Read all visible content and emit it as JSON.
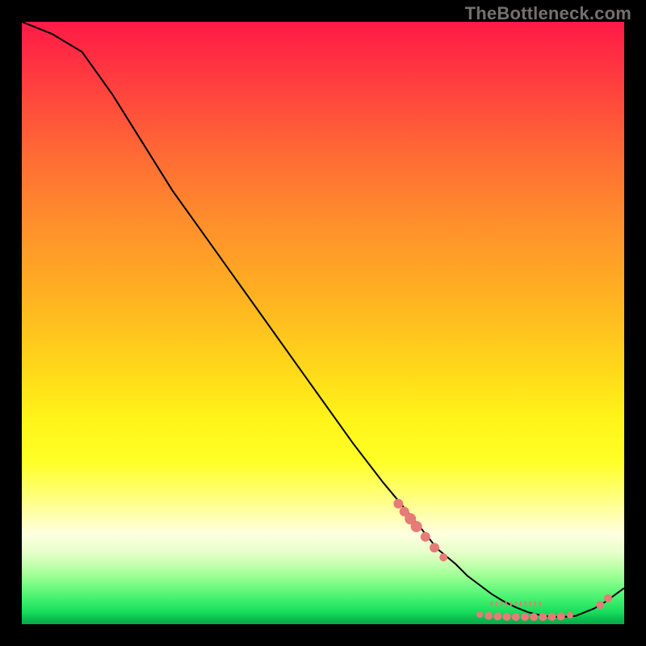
{
  "watermark": "TheBottleneck.com",
  "chart_data": {
    "type": "line",
    "title": "",
    "xlabel": "",
    "ylabel": "",
    "xlim": [
      0,
      100
    ],
    "ylim": [
      0,
      100
    ],
    "series": [
      {
        "name": "curve",
        "x": [
          0,
          5,
          10,
          15,
          20,
          25,
          30,
          35,
          40,
          45,
          50,
          55,
          60,
          65,
          67,
          69,
          72,
          74,
          76,
          78,
          80,
          82,
          84,
          86,
          88,
          90,
          92,
          95,
          97,
          100
        ],
        "y": [
          100,
          98,
          95,
          88,
          80,
          72,
          65,
          58,
          51,
          44,
          37,
          30,
          23.5,
          17.5,
          15,
          12.5,
          10,
          8,
          6.5,
          5,
          3.8,
          2.8,
          2,
          1.5,
          1.2,
          1.2,
          1.4,
          2.6,
          3.8,
          6
        ]
      }
    ],
    "markers": [
      {
        "x": 62.5,
        "y": 20,
        "r": 6
      },
      {
        "x": 63.5,
        "y": 18.7,
        "r": 6
      },
      {
        "x": 64.5,
        "y": 17.5,
        "r": 7
      },
      {
        "x": 65.5,
        "y": 16.2,
        "r": 7
      },
      {
        "x": 67,
        "y": 14.5,
        "r": 6
      },
      {
        "x": 68.5,
        "y": 12.7,
        "r": 6
      },
      {
        "x": 70,
        "y": 11.1,
        "r": 5
      },
      {
        "x": 76,
        "y": 1.6,
        "r": 4
      },
      {
        "x": 77.5,
        "y": 1.4,
        "r": 5
      },
      {
        "x": 79,
        "y": 1.3,
        "r": 5
      },
      {
        "x": 80.5,
        "y": 1.25,
        "r": 5
      },
      {
        "x": 82,
        "y": 1.2,
        "r": 5
      },
      {
        "x": 83.5,
        "y": 1.2,
        "r": 5
      },
      {
        "x": 85,
        "y": 1.2,
        "r": 5
      },
      {
        "x": 86.5,
        "y": 1.2,
        "r": 5
      },
      {
        "x": 88,
        "y": 1.25,
        "r": 5
      },
      {
        "x": 89.5,
        "y": 1.3,
        "r": 5
      },
      {
        "x": 91,
        "y": 1.5,
        "r": 4
      },
      {
        "x": 96,
        "y": 3.2,
        "r": 5
      },
      {
        "x": 97.3,
        "y": 4.3,
        "r": 5
      }
    ],
    "annotation": {
      "x": 82,
      "y": 3.4,
      "text": "",
      "color": "#f07878"
    },
    "colors": {
      "curve": "#000000",
      "marker_fill": "#e77b78",
      "marker_stroke": "#e77b78"
    }
  }
}
